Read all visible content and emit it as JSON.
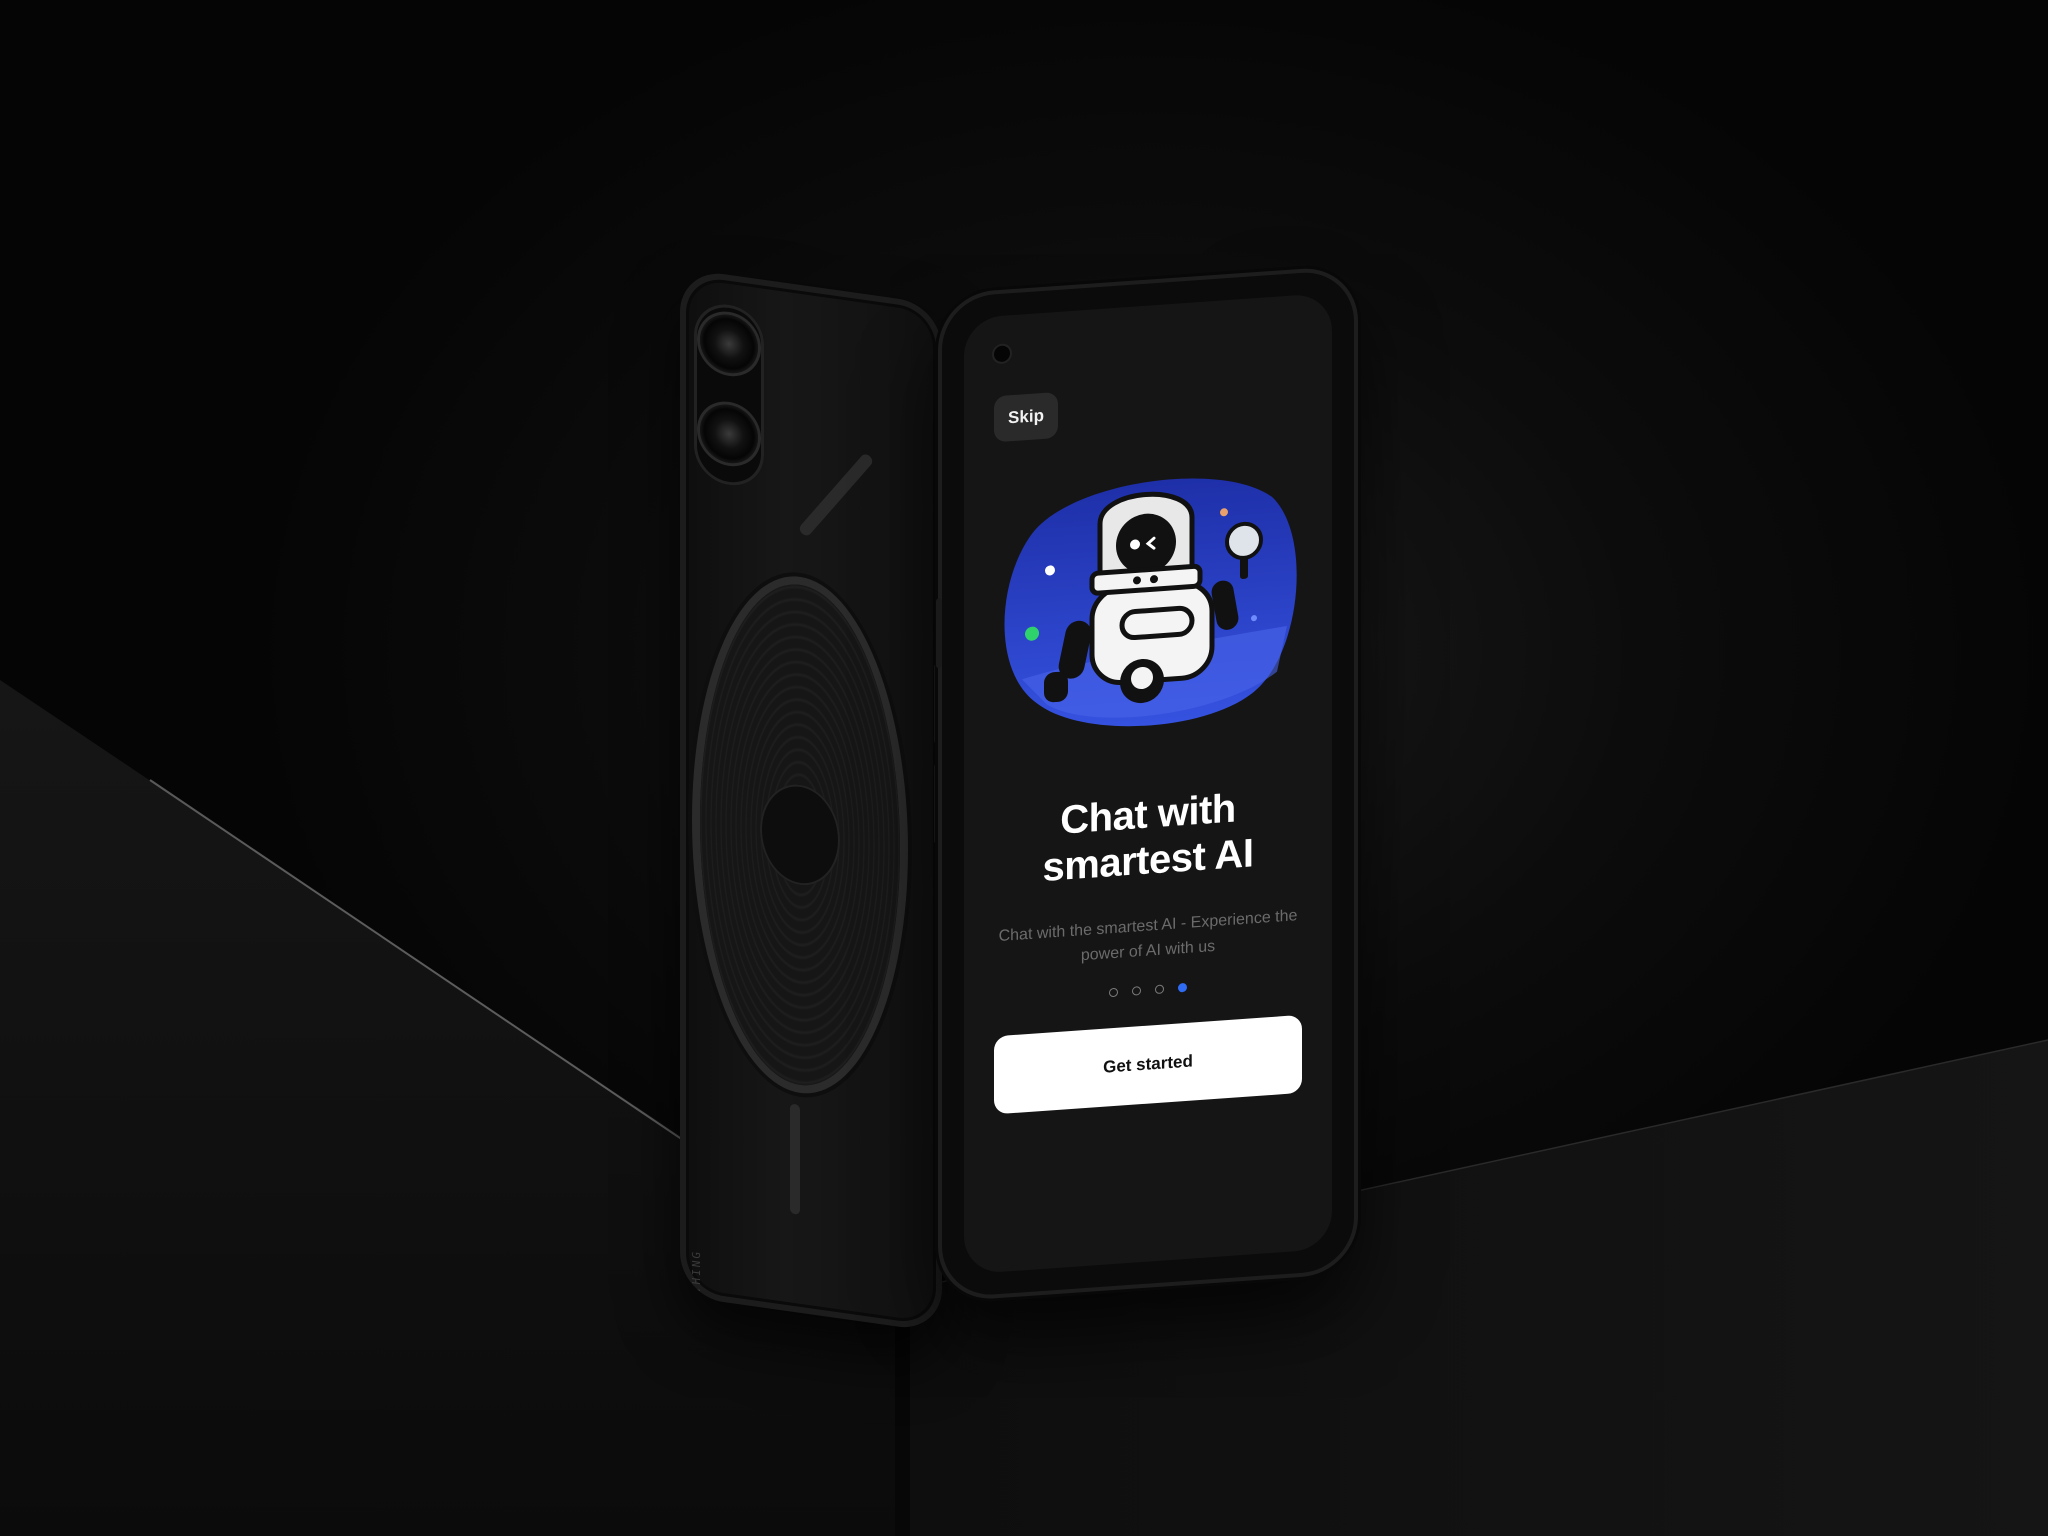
{
  "onboarding": {
    "skip_label": "Skip",
    "headline_line1": "Chat with",
    "headline_line2": "smartest AI",
    "subtext": "Chat with the smartest AI - Experience the power of AI with us",
    "cta_label": "Get started",
    "pagination": {
      "total": 4,
      "active_index": 3
    }
  },
  "device_back": {
    "brand": "NOTHING"
  },
  "colors": {
    "background": "#050505",
    "screen": "#151515",
    "accent_blue": "#2f6cf3",
    "illustration_blob": "#2a3fc9",
    "cta_bg": "#ffffff",
    "cta_text": "#111111",
    "subtext": "#6b6b6b"
  }
}
